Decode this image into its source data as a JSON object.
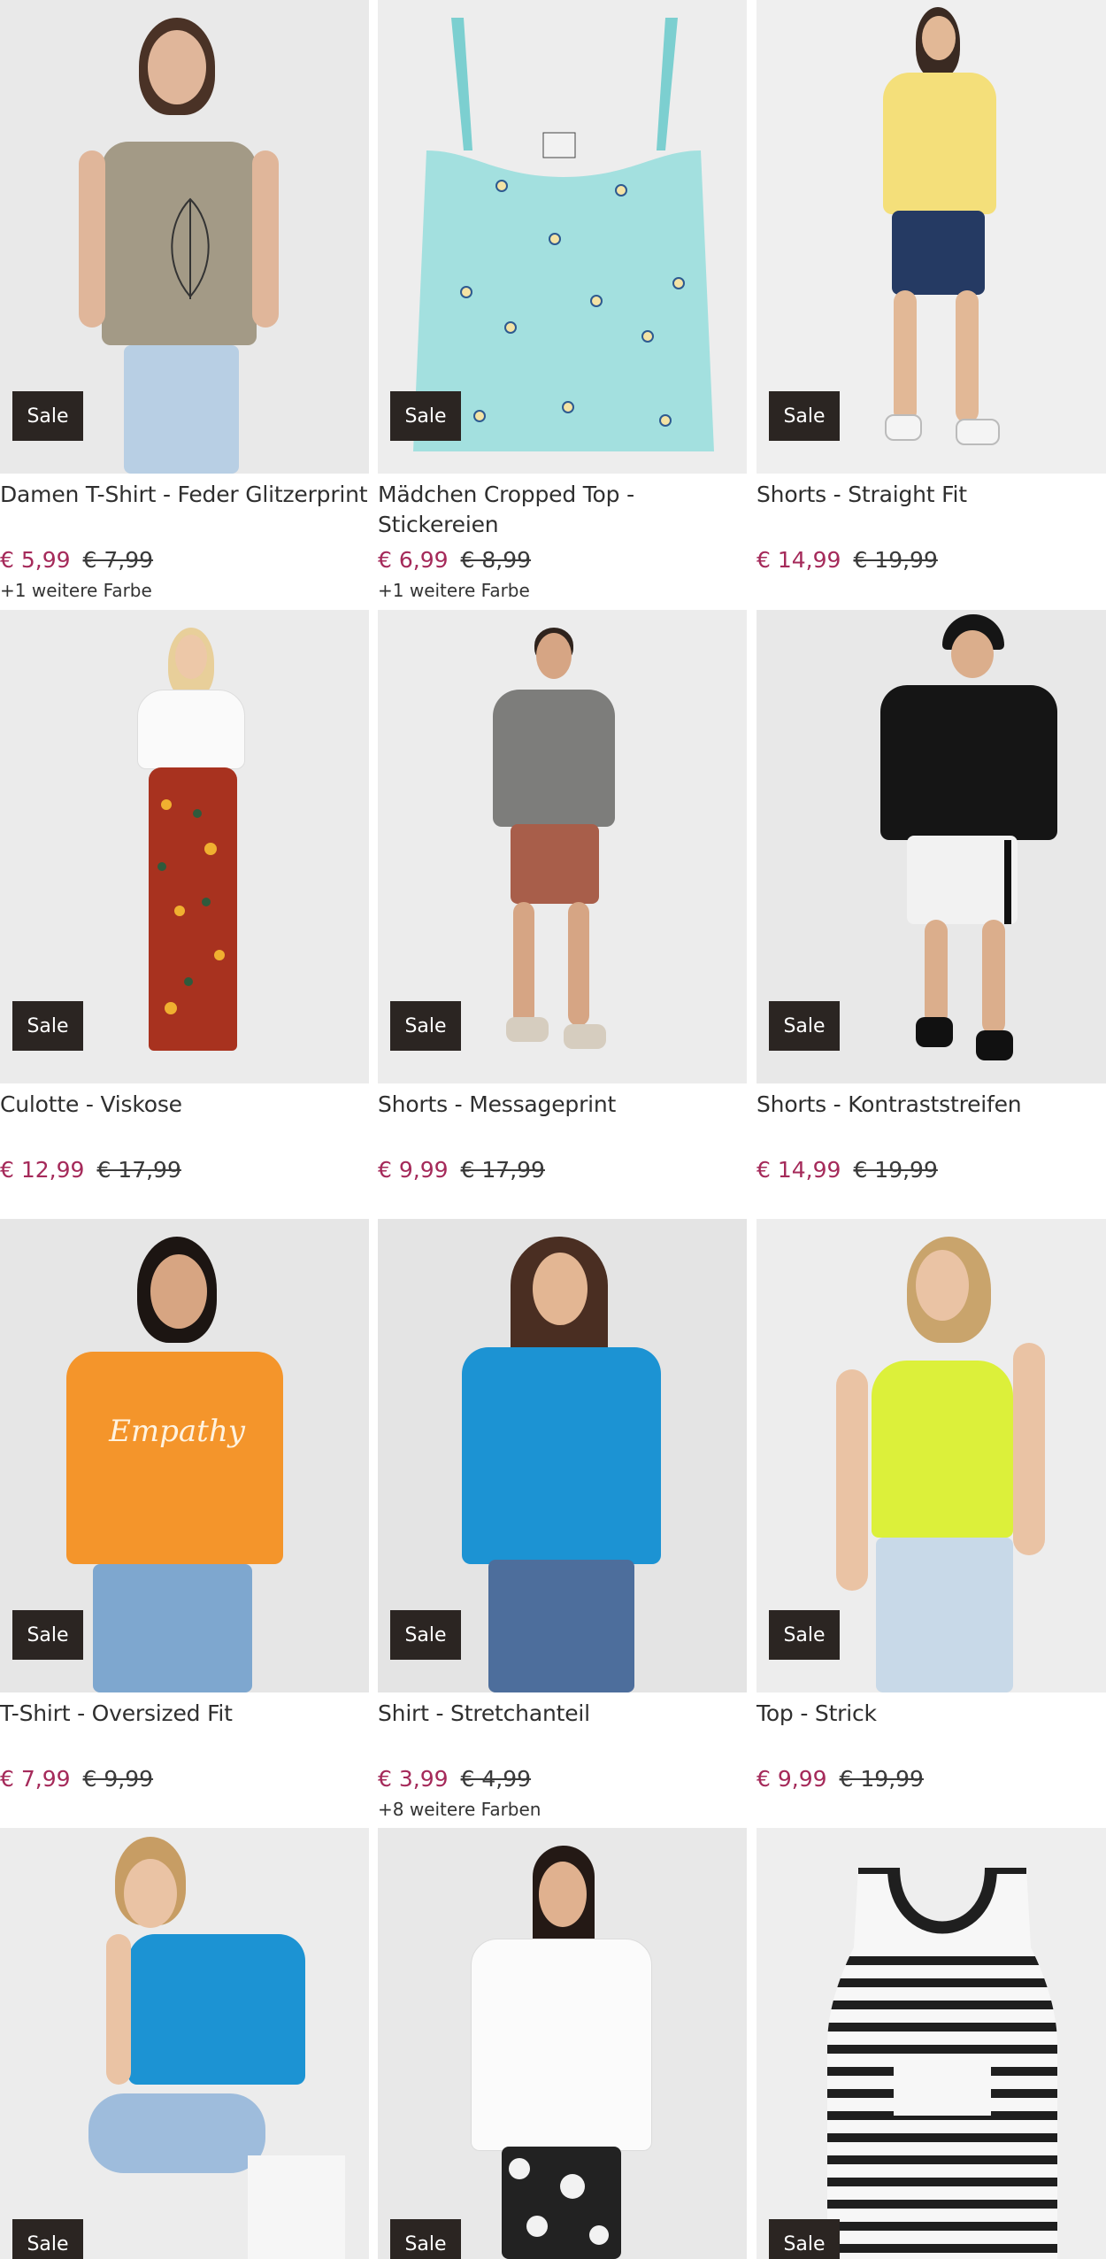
{
  "sale_label": "Sale",
  "products": [
    {
      "title": "Damen T-Shirt - Feder Glitzerprint",
      "price": "€ 5,99",
      "old_price": "€ 7,99",
      "colors": "+1 weitere Farbe",
      "image": "woman-khaki-tshirt-feather-print"
    },
    {
      "title": "Mädchen Cropped Top - Stickereien",
      "price": "€ 6,99",
      "old_price": "€ 8,99",
      "colors": "+1 weitere Farbe",
      "image": "mint-cropped-top-flower-embroidery"
    },
    {
      "title": "Shorts - Straight Fit",
      "price": "€ 14,99",
      "old_price": "€ 19,99",
      "colors": "",
      "image": "woman-yellow-tshirt-denim-shorts"
    },
    {
      "title": "Culotte - Viskose",
      "price": "€ 12,99",
      "old_price": "€ 17,99",
      "colors": "",
      "image": "woman-red-floral-culotte"
    },
    {
      "title": "Shorts - Messageprint",
      "price": "€ 9,99",
      "old_price": "€ 17,99",
      "colors": "",
      "image": "man-grey-tee-brown-shorts"
    },
    {
      "title": "Shorts - Kontraststreifen",
      "price": "€ 14,99",
      "old_price": "€ 19,99",
      "colors": "",
      "image": "man-black-hoodie-white-shorts"
    },
    {
      "title": "T-Shirt - Oversized Fit",
      "price": "€ 7,99",
      "old_price": "€ 9,99",
      "colors": "",
      "image": "woman-orange-oversized-tshirt"
    },
    {
      "title": "Shirt - Stretchanteil",
      "price": "€ 3,99",
      "old_price": "€ 4,99",
      "colors": "+8 weitere Farben",
      "image": "woman-blue-tshirt-jeans"
    },
    {
      "title": "Top - Strick",
      "price": "€ 9,99",
      "old_price": "€ 19,99",
      "colors": "",
      "image": "woman-lime-knit-top"
    },
    {
      "title": "",
      "price": "",
      "old_price": "",
      "colors": "",
      "image": "woman-blue-tshirt-sitting"
    },
    {
      "title": "",
      "price": "",
      "old_price": "",
      "colors": "",
      "image": "woman-white-tshirt-floral-pants"
    },
    {
      "title": "",
      "price": "",
      "old_price": "",
      "colors": "",
      "image": "striped-tank-top"
    }
  ],
  "colors": {
    "price_sale": "#a52a5a",
    "badge_bg": "#2b2522",
    "image_bg": "#ececec"
  }
}
